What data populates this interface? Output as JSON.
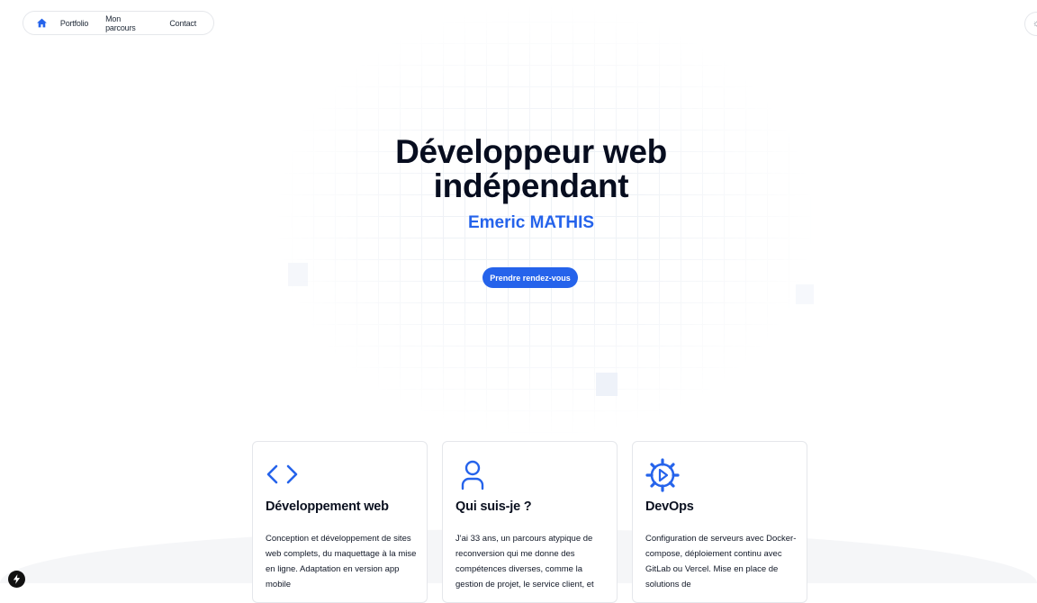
{
  "nav": {
    "items": [
      {
        "label": "Portfolio"
      },
      {
        "label": "Mon parcours"
      },
      {
        "label": "Contact"
      }
    ],
    "home_icon": "home-icon",
    "theme_icon": "sun-icon"
  },
  "hero": {
    "title_line1": "Développeur web",
    "title_line2": "indépendant",
    "subtitle": "Emeric MATHIS",
    "cta_label": "Prendre rendez-vous"
  },
  "cards": [
    {
      "icon": "code-icon",
      "title": "Développement web",
      "text": "Conception et développement de sites web complets, du maquettage à la mise en ligne. Adaptation en version app mobile"
    },
    {
      "icon": "user-icon",
      "title": "Qui suis-je ?",
      "text": "J'ai 33 ans, un parcours atypique de reconversion qui me donne des compétences diverses, comme la gestion de projet, le service client, et"
    },
    {
      "icon": "gear-icon",
      "title": "DevOps",
      "text": "Configuration de serveurs avec Docker-compose, déploiement continu avec GitLab ou Vercel. Mise en place de solutions de"
    }
  ],
  "colors": {
    "accent": "#2563eb",
    "title": "#070d1f"
  }
}
